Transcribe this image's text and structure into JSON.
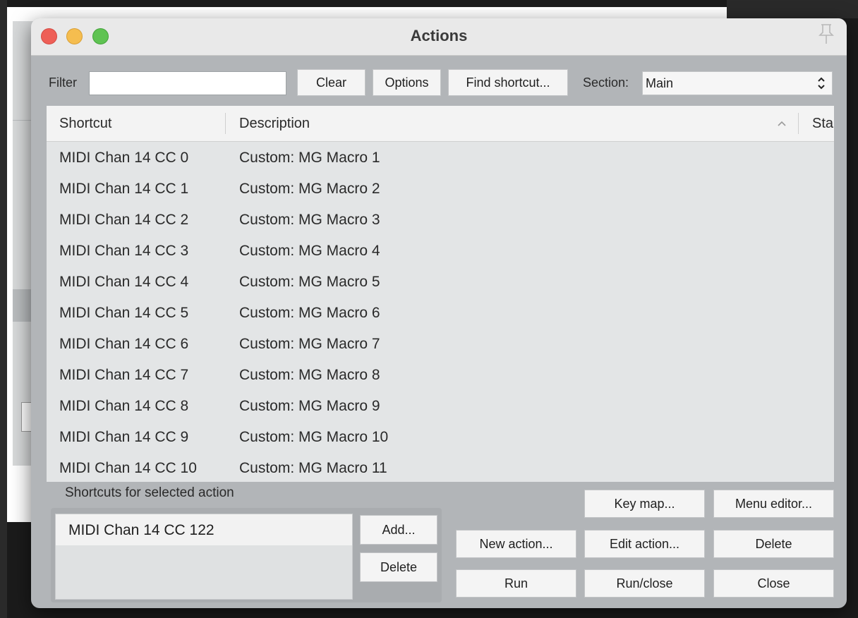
{
  "window": {
    "title": "Actions"
  },
  "filter": {
    "label": "Filter",
    "value": ""
  },
  "toolbar": {
    "clear": "Clear",
    "options": "Options",
    "find_shortcut": "Find shortcut...",
    "section_label": "Section:",
    "section_value": "Main"
  },
  "table": {
    "columns": [
      "Shortcut",
      "Description",
      "Sta"
    ],
    "rows": [
      {
        "shortcut": "MIDI Chan 14 CC 0",
        "description": "Custom: MG Macro 1"
      },
      {
        "shortcut": "MIDI Chan 14 CC 1",
        "description": "Custom: MG Macro 2"
      },
      {
        "shortcut": "MIDI Chan 14 CC 2",
        "description": "Custom: MG Macro 3"
      },
      {
        "shortcut": "MIDI Chan 14 CC 3",
        "description": "Custom: MG Macro 4"
      },
      {
        "shortcut": "MIDI Chan 14 CC 4",
        "description": "Custom: MG Macro 5"
      },
      {
        "shortcut": "MIDI Chan 14 CC 5",
        "description": "Custom: MG Macro 6"
      },
      {
        "shortcut": "MIDI Chan 14 CC 6",
        "description": "Custom: MG Macro 7"
      },
      {
        "shortcut": "MIDI Chan 14 CC 7",
        "description": "Custom: MG Macro 8"
      },
      {
        "shortcut": "MIDI Chan 14 CC 8",
        "description": "Custom: MG Macro 9"
      },
      {
        "shortcut": "MIDI Chan 14 CC 9",
        "description": "Custom: MG Macro 10"
      },
      {
        "shortcut": "MIDI Chan 14 CC 10",
        "description": "Custom: MG Macro 11"
      }
    ]
  },
  "selected_action": {
    "label": "Shortcuts for selected action",
    "shortcuts": [
      "MIDI Chan 14 CC 122"
    ],
    "add": "Add...",
    "delete": "Delete"
  },
  "actions": {
    "key_map": "Key map...",
    "menu_editor": "Menu editor...",
    "new_action": "New action...",
    "edit_action": "Edit action...",
    "delete": "Delete",
    "run": "Run",
    "run_close": "Run/close",
    "close": "Close"
  },
  "icons": [
    "close-icon",
    "minimize-icon",
    "maximize-icon",
    "pin-icon",
    "sort-ascending-icon",
    "updown-chevron-icon"
  ],
  "colors": {
    "close": "#ee5f57",
    "minimize": "#f5bd4f",
    "maximize": "#5fc352"
  }
}
